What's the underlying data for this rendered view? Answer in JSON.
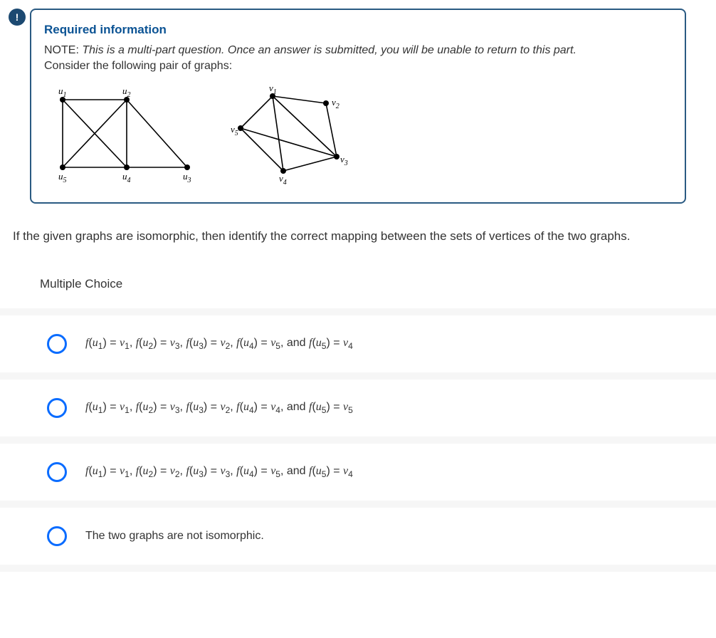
{
  "badge": "!",
  "card": {
    "title": "Required information",
    "note_label": "NOTE: ",
    "note_italic": "This is a multi-part question. Once an answer is submitted, you will be unable to return to this part.",
    "consider": "Consider the following pair of graphs:"
  },
  "graph_labels": {
    "u1": "u",
    "u1s": "1",
    "u2": "u",
    "u2s": "2",
    "u3": "u",
    "u3s": "3",
    "u4": "u",
    "u4s": "4",
    "u5": "u",
    "u5s": "5",
    "v1": "v",
    "v1s": "1",
    "v2": "v",
    "v2s": "2",
    "v3": "v",
    "v3s": "3",
    "v4": "v",
    "v4s": "4",
    "v5": "v",
    "v5s": "5"
  },
  "question": "If the given graphs are isomorphic, then identify the correct mapping between the sets of vertices of the two graphs.",
  "mc_title": "Multiple Choice",
  "choices": [
    {
      "html": "<span class='mi'>f</span>(<span class='mi'>u</span><span class='sub'>1</span>) = <span class='mi'>v</span><span class='sub'>1</span>, <span class='mi'>f</span>(<span class='mi'>u</span><span class='sub'>2</span>) = <span class='mi'>v</span><span class='sub'>3</span>, <span class='mi'>f</span>(<span class='mi'>u</span><span class='sub'>3</span>) = <span class='mi'>v</span><span class='sub'>2</span>, <span class='mi'>f</span>(<span class='mi'>u</span><span class='sub'>4</span>) = <span class='mi'>v</span><span class='sub'>5</span>, and <span class='mi'>f</span>(<span class='mi'>u</span><span class='sub'>5</span>) = <span class='mi'>v</span><span class='sub'>4</span>"
    },
    {
      "html": "<span class='mi'>f</span>(<span class='mi'>u</span><span class='sub'>1</span>) = <span class='mi'>v</span><span class='sub'>1</span>, <span class='mi'>f</span>(<span class='mi'>u</span><span class='sub'>2</span>) = <span class='mi'>v</span><span class='sub'>3</span>, <span class='mi'>f</span>(<span class='mi'>u</span><span class='sub'>3</span>) = <span class='mi'>v</span><span class='sub'>2</span>, <span class='mi'>f</span>(<span class='mi'>u</span><span class='sub'>4</span>) = <span class='mi'>v</span><span class='sub'>4</span>, and <span class='mi'>f</span>(<span class='mi'>u</span><span class='sub'>5</span>) = <span class='mi'>v</span><span class='sub'>5</span>"
    },
    {
      "html": "<span class='mi'>f</span>(<span class='mi'>u</span><span class='sub'>1</span>) = <span class='mi'>v</span><span class='sub'>1</span>, <span class='mi'>f</span>(<span class='mi'>u</span><span class='sub'>2</span>) = <span class='mi'>v</span><span class='sub'>2</span>, <span class='mi'>f</span>(<span class='mi'>u</span><span class='sub'>3</span>) = <span class='mi'>v</span><span class='sub'>3</span>, <span class='mi'>f</span>(<span class='mi'>u</span><span class='sub'>4</span>) = <span class='mi'>v</span><span class='sub'>5</span>, and <span class='mi'>f</span>(<span class='mi'>u</span><span class='sub'>5</span>) = <span class='mi'>v</span><span class='sub'>4</span>"
    },
    {
      "html": "The two graphs are not isomorphic."
    }
  ]
}
